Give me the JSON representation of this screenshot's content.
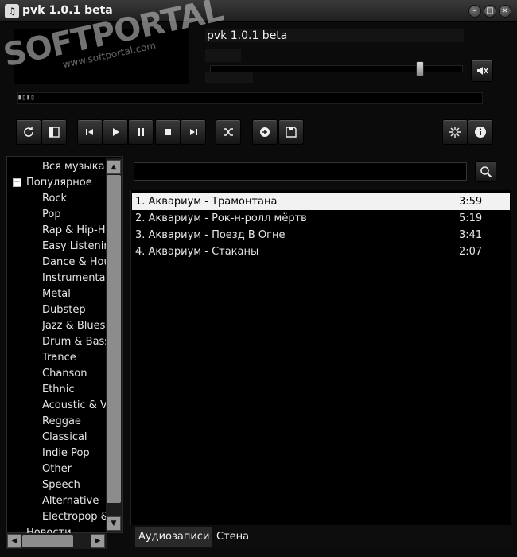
{
  "window": {
    "title": "pvk 1.0.1 beta",
    "minimize": "–",
    "maximize": "□",
    "close": "×"
  },
  "now_playing": {
    "title": "pvk 1.0.1 beta",
    "volume_fraction": 0.83
  },
  "watermark": {
    "main": "SOFTPORTAL",
    "tm": "™",
    "sub": "www.softportal.com"
  },
  "tree": {
    "all_music": "Вся музыка",
    "popular": "Популярное",
    "genres": [
      "Rock",
      "Pop",
      "Rap & Hip-Hop",
      "Easy Listening",
      "Dance & House",
      "Instrumental",
      "Metal",
      "Dubstep",
      "Jazz & Blues",
      "Drum & Bass",
      "Trance",
      "Chanson",
      "Ethnic",
      "Acoustic & Vocal",
      "Reggae",
      "Classical",
      "Indie Pop",
      "Other",
      "Speech",
      "Alternative",
      "Electropop & Disco"
    ],
    "news": "Новости"
  },
  "search": {
    "value": "",
    "placeholder": ""
  },
  "playlist": [
    {
      "title": "1. Аквариум - Трамонтана",
      "duration": "3:59"
    },
    {
      "title": "2. Аквариум - Рок-н-ролл мёртв",
      "duration": "5:19"
    },
    {
      "title": "3. Аквариум - Поезд В Огне",
      "duration": "3:41"
    },
    {
      "title": "4. Аквариум - Стаканы",
      "duration": "2:07"
    }
  ],
  "tabs": {
    "audio": "Аудиозаписи",
    "wall": "Стена"
  }
}
